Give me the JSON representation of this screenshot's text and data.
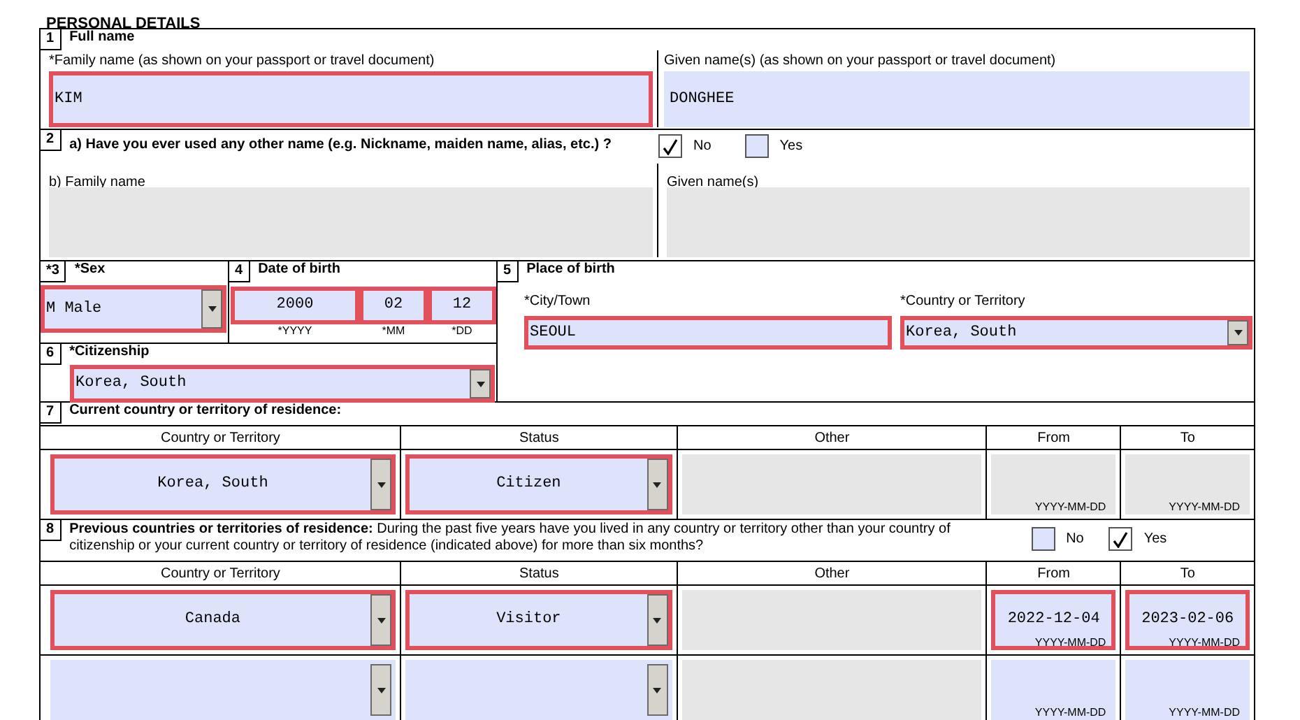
{
  "title": "PERSONAL DETAILS",
  "full_name": {
    "number": "1",
    "label": "Full name",
    "family": {
      "label": "*Family name (as shown on your passport or travel document)",
      "value": "KIM",
      "highlighted": true
    },
    "given": {
      "label": "Given name(s) (as shown on your passport or travel document)",
      "value": "DONGHEE",
      "highlighted": false
    }
  },
  "other_name": {
    "number": "2",
    "question": "a) Have you ever used any other name (e.g. Nickname, maiden name, alias, etc.) ?",
    "options": [
      {
        "label": "No",
        "checked": true
      },
      {
        "label": "Yes",
        "checked": false
      }
    ],
    "family": {
      "label": "b) Family name",
      "disabled": true
    },
    "given": {
      "label": "Given name(s)",
      "disabled": true
    }
  },
  "sex": {
    "number": "*3",
    "label": "*Sex",
    "value": "M Male",
    "highlighted": true
  },
  "date_of_birth": {
    "number": "4",
    "label": "Date of birth",
    "parts": [
      {
        "value": "2000",
        "hint": "*YYYY",
        "highlighted": true
      },
      {
        "value": "02",
        "hint": "*MM",
        "highlighted": true
      },
      {
        "value": "12",
        "hint": "*DD",
        "highlighted": true
      }
    ]
  },
  "place_of_birth": {
    "number": "5",
    "label": "Place of birth",
    "city": {
      "label": "*City/Town",
      "value": "SEOUL",
      "highlighted": true
    },
    "country": {
      "label": "*Country or Territory",
      "value": "Korea, South",
      "highlighted": true
    }
  },
  "citizenship": {
    "number": "6",
    "label": "*Citizenship",
    "value": "Korea, South",
    "highlighted": true
  },
  "current_residence": {
    "number": "7",
    "label": "Current country or territory of residence:",
    "columns": [
      "Country or Territory",
      "Status",
      "Other",
      "From",
      "To"
    ],
    "rows": [
      {
        "country": {
          "value": "Korea, South",
          "highlighted": true
        },
        "status": {
          "value": "Citizen",
          "highlighted": true
        },
        "other": {
          "disabled": true
        },
        "from": {
          "hint": "YYYY-MM-DD",
          "highlighted": false,
          "disabled": true
        },
        "to": {
          "hint": "YYYY-MM-DD",
          "highlighted": false,
          "disabled": true
        }
      }
    ]
  },
  "previous_residence": {
    "number": "8",
    "question": "**Previous countries or territories of residence:** During the past five years have you lived in any country or territory other than your country of citizenship or your current country or territory of residence (indicated above) for more than six months?",
    "options": [
      {
        "label": "No",
        "checked": false
      },
      {
        "label": "Yes",
        "checked": true
      }
    ],
    "columns": [
      "Country or Territory",
      "Status",
      "Other",
      "From",
      "To"
    ],
    "rows": [
      {
        "country": {
          "value": "Canada",
          "highlighted": true
        },
        "status": {
          "value": "Visitor",
          "highlighted": true
        },
        "other": {
          "disabled": true
        },
        "from": {
          "value": "2022-12-04",
          "hint": "YYYY-MM-DD",
          "highlighted": true,
          "disabled": false
        },
        "to": {
          "value": "2023-02-06",
          "hint": "YYYY-MM-DD",
          "highlighted": true,
          "disabled": false
        }
      },
      {
        "country": {
          "highlighted": false
        },
        "status": {
          "highlighted": false
        },
        "other": {
          "disabled": true
        },
        "from": {
          "hint": "YYYY-MM-DD",
          "highlighted": false,
          "disabled": false
        },
        "to": {
          "hint": "YYYY-MM-DD",
          "highlighted": false,
          "disabled": false
        }
      }
    ]
  }
}
